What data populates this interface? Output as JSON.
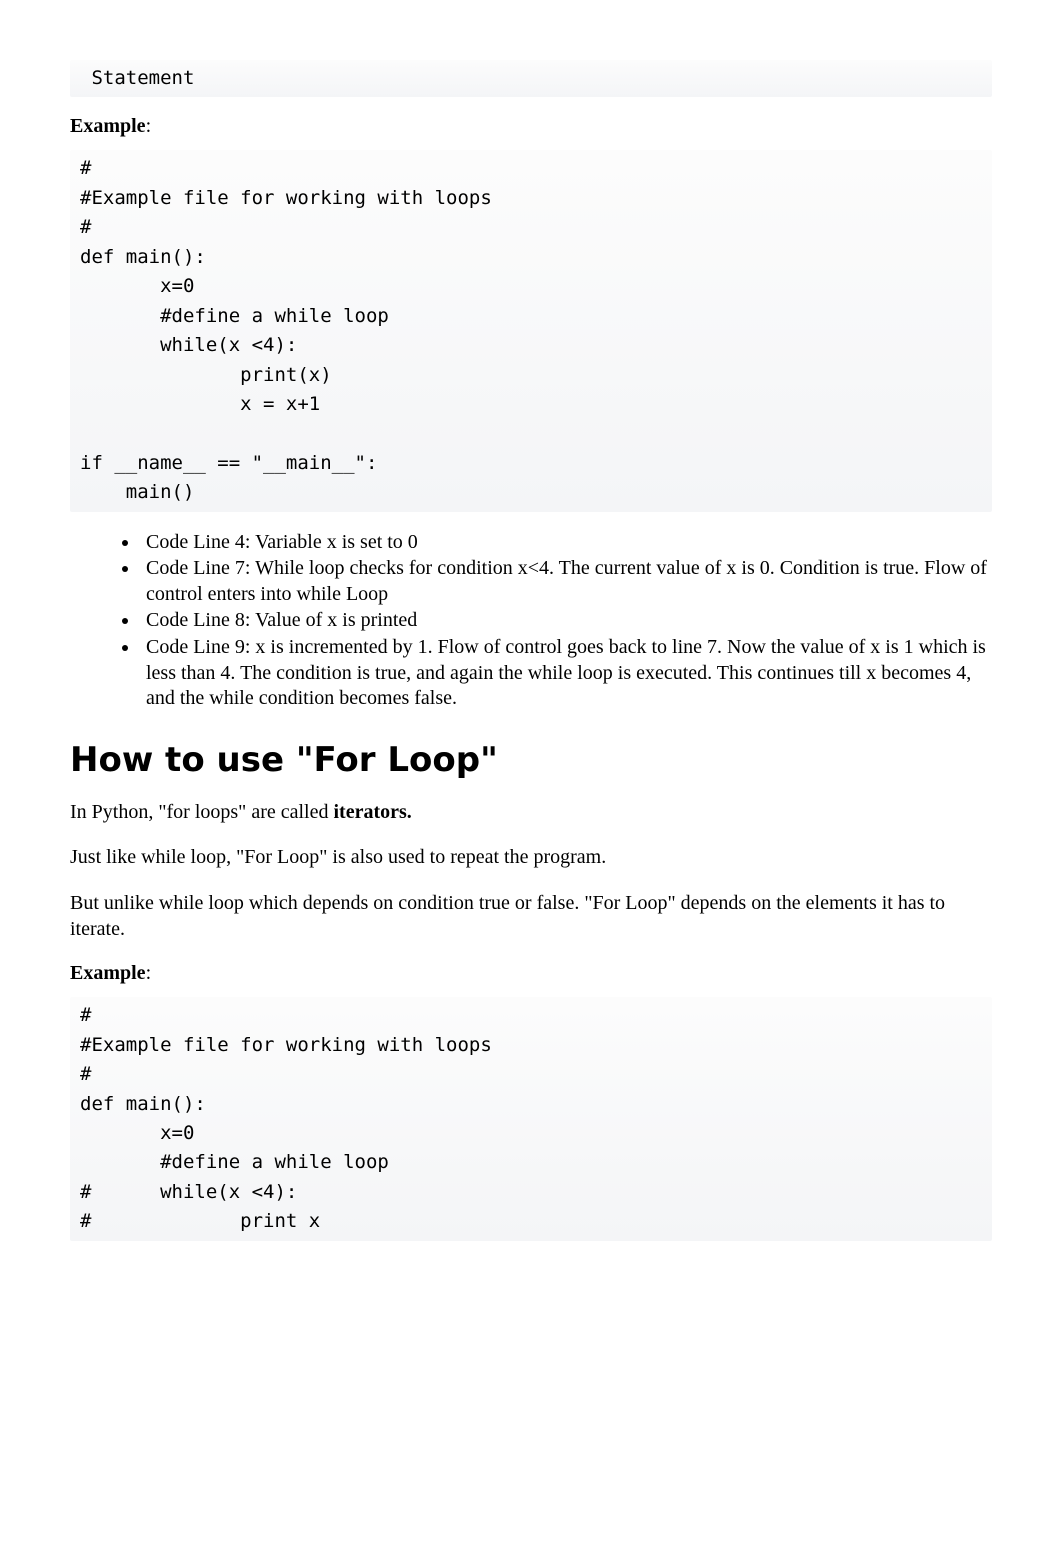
{
  "codeblock0": " Statement",
  "example1_label": "Example",
  "example1_colon": ":",
  "codeblock1": "#\n#Example file for working with loops\n#\ndef main():\n       x=0\n       #define a while loop\n       while(x <4):\n              print(x)\n              x = x+1\n\nif __name__ == \"__main__\":\n    main()",
  "bullets": [
    "Code Line 4: Variable x is set to 0",
    "Code Line 7: While loop checks for condition x<4. The current value of x is 0. Condition is true. Flow of control enters into while Loop",
    "Code Line 8: Value of x is printed",
    "Code Line 9: x is incremented by 1. Flow of control goes back to line 7. Now the value of x is 1 which is less than 4. The condition is true, and again the while loop is executed. This continues till x becomes 4, and the while condition becomes false."
  ],
  "heading_for_loop": "How to use \"For Loop\"",
  "para1_pre": "In Python, \"for loops\" are called ",
  "para1_bold": "iterators.",
  "para2": "Just like while loop, \"For Loop\" is also used to repeat the program.",
  "para3": "But unlike while loop which depends on condition true or false. \"For Loop\" depends on the elements it has to iterate.",
  "example2_label": "Example",
  "example2_colon": ":",
  "codeblock2": "#\n#Example file for working with loops\n#\ndef main():\n       x=0\n       #define a while loop\n#      while(x <4):\n#             print x"
}
